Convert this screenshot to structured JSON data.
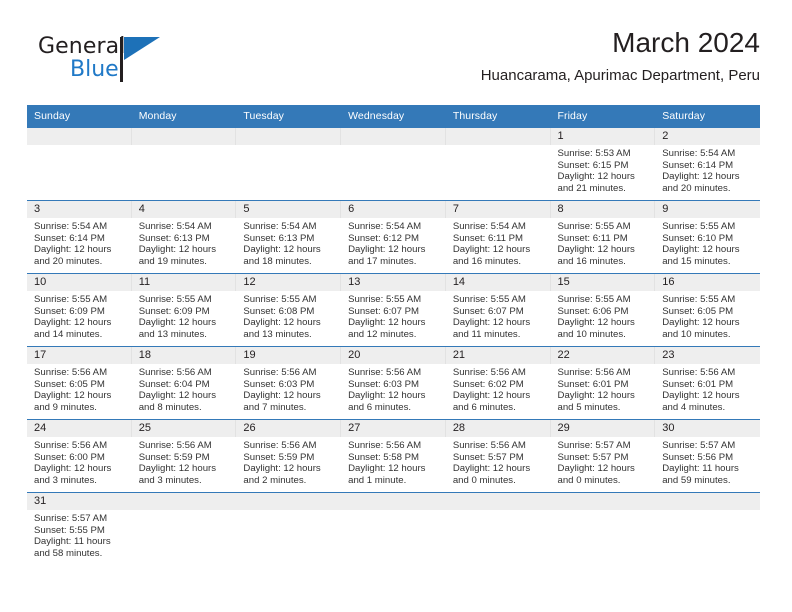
{
  "brand": {
    "name_top": "General",
    "name_bottom": "Blue",
    "logo_icon": "flag-triangle-icon",
    "accent_color": "#2079c7"
  },
  "header": {
    "month_title": "March 2024",
    "location": "Huancarama, Apurimac Department, Peru"
  },
  "calendar": {
    "header_color": "#3479b8",
    "daynum_band_color": "#eeeeee",
    "weekday_headers": [
      "Sunday",
      "Monday",
      "Tuesday",
      "Wednesday",
      "Thursday",
      "Friday",
      "Saturday"
    ],
    "weeks": [
      [
        {
          "day": "",
          "sunrise": "",
          "sunset": "",
          "daylight_line1": "",
          "daylight_line2": ""
        },
        {
          "day": "",
          "sunrise": "",
          "sunset": "",
          "daylight_line1": "",
          "daylight_line2": ""
        },
        {
          "day": "",
          "sunrise": "",
          "sunset": "",
          "daylight_line1": "",
          "daylight_line2": ""
        },
        {
          "day": "",
          "sunrise": "",
          "sunset": "",
          "daylight_line1": "",
          "daylight_line2": ""
        },
        {
          "day": "",
          "sunrise": "",
          "sunset": "",
          "daylight_line1": "",
          "daylight_line2": ""
        },
        {
          "day": "1",
          "sunrise": "Sunrise: 5:53 AM",
          "sunset": "Sunset: 6:15 PM",
          "daylight_line1": "Daylight: 12 hours",
          "daylight_line2": "and 21 minutes."
        },
        {
          "day": "2",
          "sunrise": "Sunrise: 5:54 AM",
          "sunset": "Sunset: 6:14 PM",
          "daylight_line1": "Daylight: 12 hours",
          "daylight_line2": "and 20 minutes."
        }
      ],
      [
        {
          "day": "3",
          "sunrise": "Sunrise: 5:54 AM",
          "sunset": "Sunset: 6:14 PM",
          "daylight_line1": "Daylight: 12 hours",
          "daylight_line2": "and 20 minutes."
        },
        {
          "day": "4",
          "sunrise": "Sunrise: 5:54 AM",
          "sunset": "Sunset: 6:13 PM",
          "daylight_line1": "Daylight: 12 hours",
          "daylight_line2": "and 19 minutes."
        },
        {
          "day": "5",
          "sunrise": "Sunrise: 5:54 AM",
          "sunset": "Sunset: 6:13 PM",
          "daylight_line1": "Daylight: 12 hours",
          "daylight_line2": "and 18 minutes."
        },
        {
          "day": "6",
          "sunrise": "Sunrise: 5:54 AM",
          "sunset": "Sunset: 6:12 PM",
          "daylight_line1": "Daylight: 12 hours",
          "daylight_line2": "and 17 minutes."
        },
        {
          "day": "7",
          "sunrise": "Sunrise: 5:54 AM",
          "sunset": "Sunset: 6:11 PM",
          "daylight_line1": "Daylight: 12 hours",
          "daylight_line2": "and 16 minutes."
        },
        {
          "day": "8",
          "sunrise": "Sunrise: 5:55 AM",
          "sunset": "Sunset: 6:11 PM",
          "daylight_line1": "Daylight: 12 hours",
          "daylight_line2": "and 16 minutes."
        },
        {
          "day": "9",
          "sunrise": "Sunrise: 5:55 AM",
          "sunset": "Sunset: 6:10 PM",
          "daylight_line1": "Daylight: 12 hours",
          "daylight_line2": "and 15 minutes."
        }
      ],
      [
        {
          "day": "10",
          "sunrise": "Sunrise: 5:55 AM",
          "sunset": "Sunset: 6:09 PM",
          "daylight_line1": "Daylight: 12 hours",
          "daylight_line2": "and 14 minutes."
        },
        {
          "day": "11",
          "sunrise": "Sunrise: 5:55 AM",
          "sunset": "Sunset: 6:09 PM",
          "daylight_line1": "Daylight: 12 hours",
          "daylight_line2": "and 13 minutes."
        },
        {
          "day": "12",
          "sunrise": "Sunrise: 5:55 AM",
          "sunset": "Sunset: 6:08 PM",
          "daylight_line1": "Daylight: 12 hours",
          "daylight_line2": "and 13 minutes."
        },
        {
          "day": "13",
          "sunrise": "Sunrise: 5:55 AM",
          "sunset": "Sunset: 6:07 PM",
          "daylight_line1": "Daylight: 12 hours",
          "daylight_line2": "and 12 minutes."
        },
        {
          "day": "14",
          "sunrise": "Sunrise: 5:55 AM",
          "sunset": "Sunset: 6:07 PM",
          "daylight_line1": "Daylight: 12 hours",
          "daylight_line2": "and 11 minutes."
        },
        {
          "day": "15",
          "sunrise": "Sunrise: 5:55 AM",
          "sunset": "Sunset: 6:06 PM",
          "daylight_line1": "Daylight: 12 hours",
          "daylight_line2": "and 10 minutes."
        },
        {
          "day": "16",
          "sunrise": "Sunrise: 5:55 AM",
          "sunset": "Sunset: 6:05 PM",
          "daylight_line1": "Daylight: 12 hours",
          "daylight_line2": "and 10 minutes."
        }
      ],
      [
        {
          "day": "17",
          "sunrise": "Sunrise: 5:56 AM",
          "sunset": "Sunset: 6:05 PM",
          "daylight_line1": "Daylight: 12 hours",
          "daylight_line2": "and 9 minutes."
        },
        {
          "day": "18",
          "sunrise": "Sunrise: 5:56 AM",
          "sunset": "Sunset: 6:04 PM",
          "daylight_line1": "Daylight: 12 hours",
          "daylight_line2": "and 8 minutes."
        },
        {
          "day": "19",
          "sunrise": "Sunrise: 5:56 AM",
          "sunset": "Sunset: 6:03 PM",
          "daylight_line1": "Daylight: 12 hours",
          "daylight_line2": "and 7 minutes."
        },
        {
          "day": "20",
          "sunrise": "Sunrise: 5:56 AM",
          "sunset": "Sunset: 6:03 PM",
          "daylight_line1": "Daylight: 12 hours",
          "daylight_line2": "and 6 minutes."
        },
        {
          "day": "21",
          "sunrise": "Sunrise: 5:56 AM",
          "sunset": "Sunset: 6:02 PM",
          "daylight_line1": "Daylight: 12 hours",
          "daylight_line2": "and 6 minutes."
        },
        {
          "day": "22",
          "sunrise": "Sunrise: 5:56 AM",
          "sunset": "Sunset: 6:01 PM",
          "daylight_line1": "Daylight: 12 hours",
          "daylight_line2": "and 5 minutes."
        },
        {
          "day": "23",
          "sunrise": "Sunrise: 5:56 AM",
          "sunset": "Sunset: 6:01 PM",
          "daylight_line1": "Daylight: 12 hours",
          "daylight_line2": "and 4 minutes."
        }
      ],
      [
        {
          "day": "24",
          "sunrise": "Sunrise: 5:56 AM",
          "sunset": "Sunset: 6:00 PM",
          "daylight_line1": "Daylight: 12 hours",
          "daylight_line2": "and 3 minutes."
        },
        {
          "day": "25",
          "sunrise": "Sunrise: 5:56 AM",
          "sunset": "Sunset: 5:59 PM",
          "daylight_line1": "Daylight: 12 hours",
          "daylight_line2": "and 3 minutes."
        },
        {
          "day": "26",
          "sunrise": "Sunrise: 5:56 AM",
          "sunset": "Sunset: 5:59 PM",
          "daylight_line1": "Daylight: 12 hours",
          "daylight_line2": "and 2 minutes."
        },
        {
          "day": "27",
          "sunrise": "Sunrise: 5:56 AM",
          "sunset": "Sunset: 5:58 PM",
          "daylight_line1": "Daylight: 12 hours",
          "daylight_line2": "and 1 minute."
        },
        {
          "day": "28",
          "sunrise": "Sunrise: 5:56 AM",
          "sunset": "Sunset: 5:57 PM",
          "daylight_line1": "Daylight: 12 hours",
          "daylight_line2": "and 0 minutes."
        },
        {
          "day": "29",
          "sunrise": "Sunrise: 5:57 AM",
          "sunset": "Sunset: 5:57 PM",
          "daylight_line1": "Daylight: 12 hours",
          "daylight_line2": "and 0 minutes."
        },
        {
          "day": "30",
          "sunrise": "Sunrise: 5:57 AM",
          "sunset": "Sunset: 5:56 PM",
          "daylight_line1": "Daylight: 11 hours",
          "daylight_line2": "and 59 minutes."
        }
      ],
      [
        {
          "day": "31",
          "sunrise": "Sunrise: 5:57 AM",
          "sunset": "Sunset: 5:55 PM",
          "daylight_line1": "Daylight: 11 hours",
          "daylight_line2": "and 58 minutes."
        },
        {
          "day": "",
          "sunrise": "",
          "sunset": "",
          "daylight_line1": "",
          "daylight_line2": ""
        },
        {
          "day": "",
          "sunrise": "",
          "sunset": "",
          "daylight_line1": "",
          "daylight_line2": ""
        },
        {
          "day": "",
          "sunrise": "",
          "sunset": "",
          "daylight_line1": "",
          "daylight_line2": ""
        },
        {
          "day": "",
          "sunrise": "",
          "sunset": "",
          "daylight_line1": "",
          "daylight_line2": ""
        },
        {
          "day": "",
          "sunrise": "",
          "sunset": "",
          "daylight_line1": "",
          "daylight_line2": ""
        },
        {
          "day": "",
          "sunrise": "",
          "sunset": "",
          "daylight_line1": "",
          "daylight_line2": ""
        }
      ]
    ]
  }
}
